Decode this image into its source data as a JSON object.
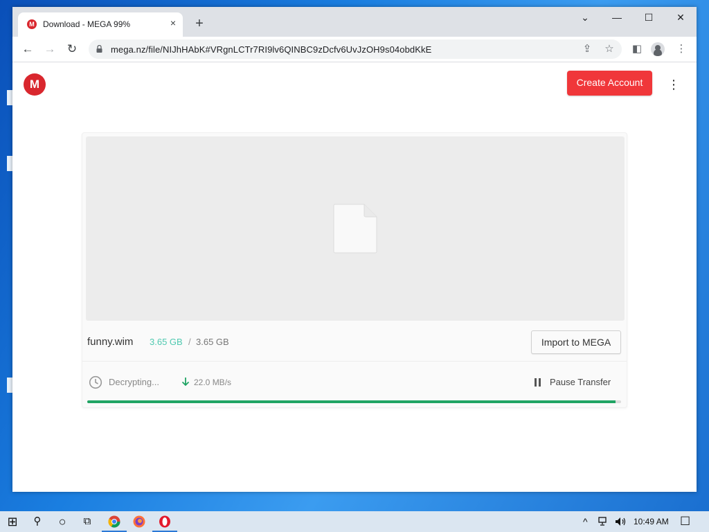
{
  "browser": {
    "tab": {
      "title": "Download - MEGA 99%",
      "favicon_letter": "M",
      "close_icon": "×"
    },
    "new_tab_icon": "+",
    "window_controls": {
      "tablist": "⌄",
      "minimize": "—",
      "maximize": "☐",
      "close": "✕"
    },
    "nav": {
      "back": "←",
      "forward": "→",
      "reload": "↻"
    },
    "url": "mega.nz/file/NIJhHAbK#VRgnLCTr7RI9lv6QINBC9zDcfv6UvJzOH9s04obdKkE",
    "icons": {
      "share": "⇪",
      "bookmark": "☆",
      "sidebar": "◧",
      "menu": "⋮"
    }
  },
  "page": {
    "logo_letter": "M",
    "create_account": "Create Account",
    "kebab": "⋮",
    "file": {
      "name": "funny.wim",
      "downloaded": "3.65 GB",
      "separator": "/",
      "total": "3.65 GB",
      "import_button": "Import to MEGA",
      "status": "Decrypting...",
      "speed": "22.0 MB/s",
      "pause_button": "Pause Transfer",
      "progress_percent": 99
    }
  },
  "colors": {
    "mega_red": "#d9272e",
    "button_red": "#f0373a",
    "progress_green": "#20a464",
    "size_teal": "#4fc9b0"
  },
  "taskbar": {
    "start": "⊞",
    "search": "⚲",
    "cortana": "○",
    "task_view": "⧉",
    "chevron": "^",
    "time": "10:49 AM",
    "notification": "☐"
  }
}
